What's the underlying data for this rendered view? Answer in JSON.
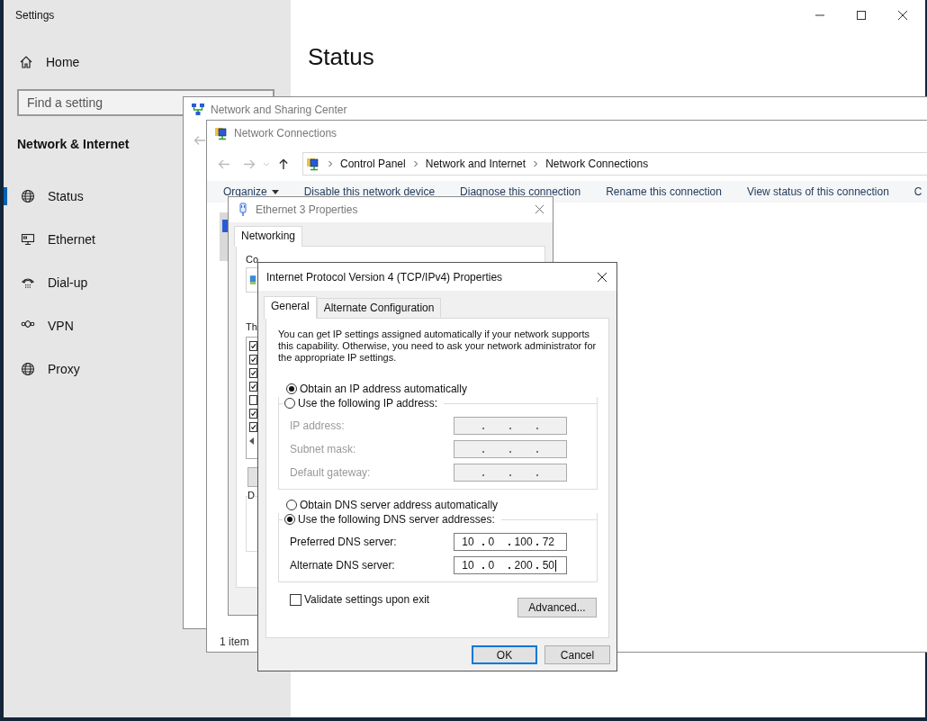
{
  "settings": {
    "title": "Settings",
    "home": "Home",
    "search": {
      "placeholder": "Find a setting"
    },
    "section": "Network & Internet",
    "nav": [
      {
        "label": "Status",
        "kind": "globe",
        "selected": true
      },
      {
        "label": "Ethernet",
        "kind": "monitor",
        "selected": false
      },
      {
        "label": "Dial-up",
        "kind": "phone",
        "selected": false
      },
      {
        "label": "VPN",
        "kind": "vpn",
        "selected": false
      },
      {
        "label": "Proxy",
        "kind": "globe",
        "selected": false
      }
    ],
    "page_title": "Status"
  },
  "sharing_center": {
    "title": "Network and Sharing Center"
  },
  "connections": {
    "title": "Network Connections",
    "breadcrumb": [
      "Control Panel",
      "Network and Internet",
      "Network Connections"
    ],
    "toolbar": [
      {
        "label": "Organize",
        "kind": "menu"
      },
      {
        "label": "Disable this network device",
        "kind": "action"
      },
      {
        "label": "Diagnose this connection",
        "kind": "action"
      },
      {
        "label": "Rename this connection",
        "kind": "action"
      },
      {
        "label": "View status of this connection",
        "kind": "action"
      },
      {
        "label": "C",
        "kind": "action"
      }
    ],
    "status": "1 item"
  },
  "ethernet_properties": {
    "title": "Ethernet 3 Properties",
    "tabs": [
      {
        "label": "Networking",
        "selected": true
      }
    ],
    "label_1": "Co",
    "label_2": "Th",
    "group_label": "D",
    "components": [
      {
        "checked": true
      },
      {
        "checked": true
      },
      {
        "checked": true
      },
      {
        "checked": true
      },
      {
        "checked": false
      },
      {
        "checked": true
      },
      {
        "checked": true
      }
    ]
  },
  "ipv4": {
    "title": "Internet Protocol Version 4 (TCP/IPv4) Properties",
    "tabs": [
      {
        "label": "General",
        "selected": true
      },
      {
        "label": "Alternate Configuration",
        "selected": false
      }
    ],
    "intro": "You can get IP settings assigned automatically if your network supports this capability. Otherwise, you need to ask your network administrator for the appropriate IP settings.",
    "ip_mode": [
      {
        "label": "Obtain an IP address automatically",
        "selected": true
      },
      {
        "label": "Use the following IP address:",
        "selected": false
      }
    ],
    "ip_fields": [
      {
        "label": "IP address:",
        "disabled": true
      },
      {
        "label": "Subnet mask:",
        "disabled": true
      },
      {
        "label": "Default gateway:",
        "disabled": true
      }
    ],
    "dns_mode": [
      {
        "label": "Obtain DNS server address automatically",
        "selected": false
      },
      {
        "label": "Use the following DNS server addresses:",
        "selected": true
      }
    ],
    "dns_fields": [
      {
        "label": "Preferred DNS server:",
        "disabled": false,
        "octets": [
          "10",
          "0",
          "100",
          "72"
        ],
        "focused": false
      },
      {
        "label": "Alternate DNS server:",
        "disabled": false,
        "octets": [
          "10",
          "0",
          "200",
          "50"
        ],
        "focused": true
      }
    ],
    "validate": {
      "label": "Validate settings upon exit",
      "checked": false
    },
    "advanced": "Advanced...",
    "buttons": [
      {
        "label": "OK",
        "default": true
      },
      {
        "label": "Cancel",
        "default": false
      }
    ]
  }
}
